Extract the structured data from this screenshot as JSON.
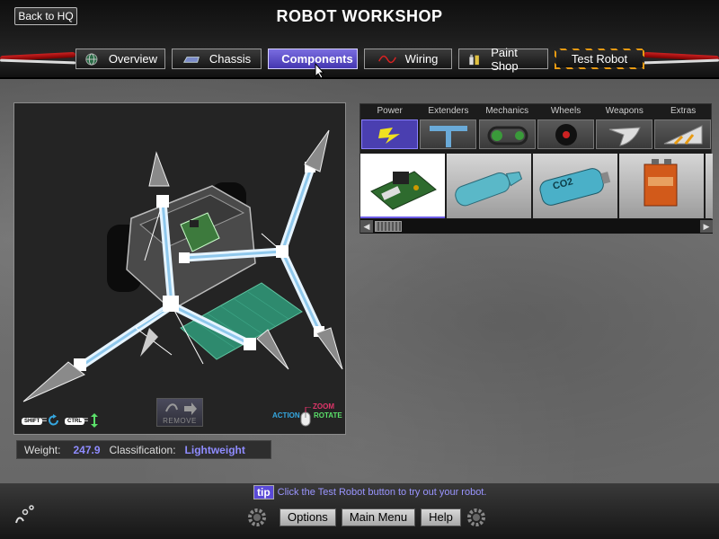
{
  "header": {
    "back_label": "Back to HQ",
    "title": "ROBOT WORKSHOP"
  },
  "tabs": [
    {
      "label": "Overview",
      "icon": "globe-icon",
      "active": false
    },
    {
      "label": "Chassis",
      "icon": "chassis-icon",
      "active": false
    },
    {
      "label": "Components",
      "icon": "gear-icon",
      "active": true
    },
    {
      "label": "Wiring",
      "icon": "wire-icon",
      "active": false
    },
    {
      "label": "Paint Shop",
      "icon": "paint-icon",
      "active": false
    },
    {
      "label": "Test Robot",
      "icon": "",
      "active": false
    }
  ],
  "viewport": {
    "remove_label": "REMOVE",
    "shift_key": "SHIFT",
    "ctrl_key": "CTRL",
    "eq": "=",
    "action_label": "ACTION",
    "zoom_label": "ZOOM",
    "rotate_label": "ROTATE"
  },
  "stats": {
    "weight_label": "Weight:",
    "weight_value": "247.9",
    "class_label": "Classification:",
    "class_value": "Lightweight"
  },
  "categories": [
    {
      "label": "Power",
      "icon": "lightning-icon",
      "active": true
    },
    {
      "label": "Extenders",
      "icon": "extender-icon",
      "active": false
    },
    {
      "label": "Mechanics",
      "icon": "chain-icon",
      "active": false
    },
    {
      "label": "Wheels",
      "icon": "wheel-icon",
      "active": false
    },
    {
      "label": "Weapons",
      "icon": "blade-icon",
      "active": false
    },
    {
      "label": "Extras",
      "icon": "wedge-icon",
      "active": false
    }
  ],
  "items": [
    {
      "name": "circuit-board",
      "active": true
    },
    {
      "name": "tank",
      "label": "",
      "active": false
    },
    {
      "name": "co2-tank",
      "label": "CO2",
      "active": false
    },
    {
      "name": "battery",
      "label": "",
      "active": false
    }
  ],
  "footer": {
    "tip_badge": "tip",
    "tip_text": "Click the Test Robot button to try out your robot.",
    "options_label": "Options",
    "main_menu_label": "Main Menu",
    "help_label": "Help"
  },
  "colors": {
    "accent": "#5a4ad8",
    "value_text": "#8f8cff",
    "hazard": "#e89a12"
  }
}
